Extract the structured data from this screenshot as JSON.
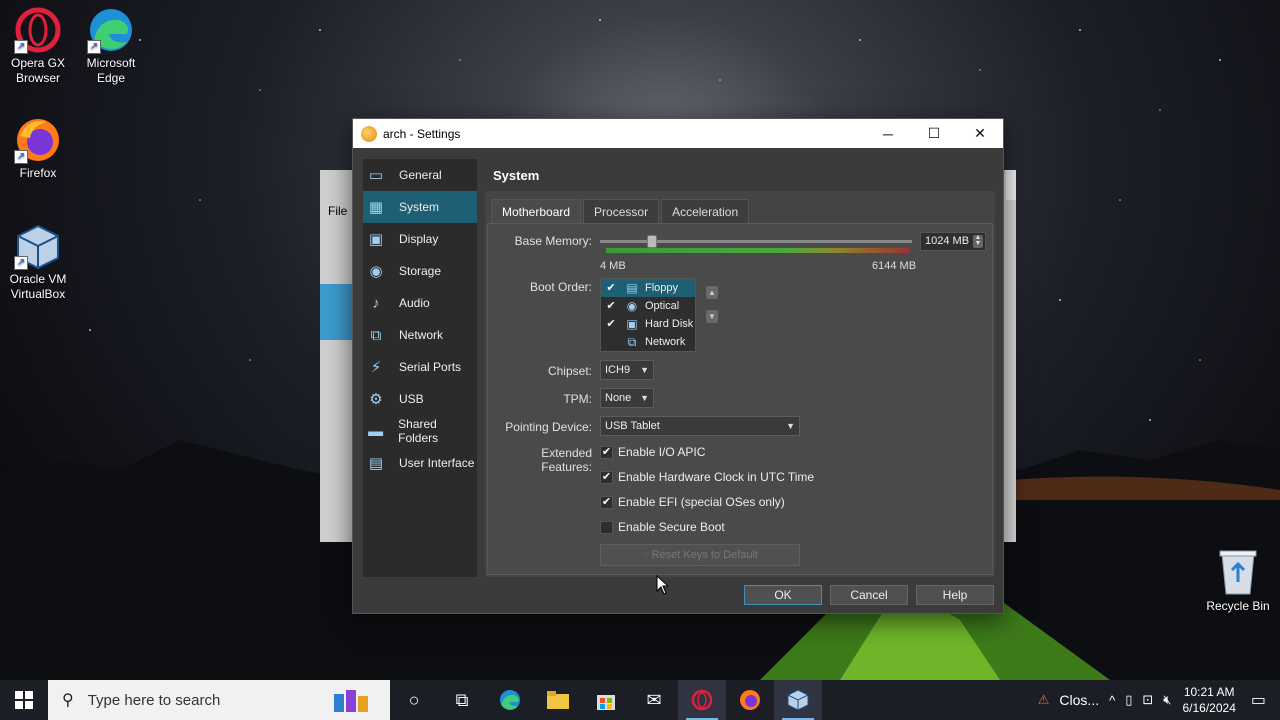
{
  "desktop": {
    "icons": [
      {
        "label": "Opera GX Browser",
        "icon": "opera-gx-icon"
      },
      {
        "label": "Microsoft Edge",
        "icon": "edge-icon"
      },
      {
        "label": "Firefox",
        "icon": "firefox-icon"
      },
      {
        "label": "Oracle VM VirtualBox",
        "icon": "virtualbox-icon"
      }
    ],
    "recycle_bin": "Recycle Bin"
  },
  "background_window": {
    "file_menu": "File"
  },
  "dialog": {
    "title": "arch - Settings",
    "window_buttons": {
      "minimize": "─",
      "maximize": "☐",
      "close": "✕"
    },
    "sidebar": [
      {
        "label": "General",
        "icon": "general-icon",
        "glyph": "▭"
      },
      {
        "label": "System",
        "icon": "system-icon",
        "glyph": "▦",
        "active": true
      },
      {
        "label": "Display",
        "icon": "display-icon",
        "glyph": "▣"
      },
      {
        "label": "Storage",
        "icon": "storage-icon",
        "glyph": "◉"
      },
      {
        "label": "Audio",
        "icon": "audio-icon",
        "glyph": "♪"
      },
      {
        "label": "Network",
        "icon": "network-icon",
        "glyph": "⧉"
      },
      {
        "label": "Serial Ports",
        "icon": "serial-ports-icon",
        "glyph": "⚡"
      },
      {
        "label": "USB",
        "icon": "usb-icon",
        "glyph": "⚙"
      },
      {
        "label": "Shared Folders",
        "icon": "shared-folders-icon",
        "glyph": "▬"
      },
      {
        "label": "User Interface",
        "icon": "user-interface-icon",
        "glyph": "▤"
      }
    ],
    "section_title": "System",
    "tabs": [
      {
        "label": "Motherboard",
        "active": true
      },
      {
        "label": "Processor"
      },
      {
        "label": "Acceleration"
      }
    ],
    "motherboard": {
      "base_memory_label": "Base Memory:",
      "base_memory_value": "1024 MB",
      "base_memory_fraction": 0.167,
      "memory_min": "4 MB",
      "memory_max": "6144 MB",
      "boot_order_label": "Boot Order:",
      "boot_order": [
        {
          "label": "Floppy",
          "checked": true,
          "icon": "floppy-icon",
          "glyph": "▤",
          "selected": true
        },
        {
          "label": "Optical",
          "checked": true,
          "icon": "optical-icon",
          "glyph": "◉"
        },
        {
          "label": "Hard Disk",
          "checked": true,
          "icon": "hard-disk-icon",
          "glyph": "▣"
        },
        {
          "label": "Network",
          "checked": false,
          "icon": "network-boot-icon",
          "glyph": "⧉"
        }
      ],
      "chipset_label": "Chipset:",
      "chipset_value": "ICH9",
      "tpm_label": "TPM:",
      "tpm_value": "None",
      "pointing_label": "Pointing Device:",
      "pointing_value": "USB Tablet",
      "extended_label": "Extended Features:",
      "features": [
        {
          "label": "Enable I/O APIC",
          "checked": true
        },
        {
          "label": "Enable Hardware Clock in UTC Time",
          "checked": true
        },
        {
          "label": "Enable EFI (special OSes only)",
          "checked": true
        },
        {
          "label": "Enable Secure Boot",
          "checked": false
        }
      ],
      "reset_keys": "Reset Keys to Default"
    },
    "buttons": {
      "ok": "OK",
      "cancel": "Cancel",
      "help": "Help"
    }
  },
  "taskbar": {
    "search_placeholder": "Type here to search",
    "tray_notification": "Clos...",
    "time": "10:21 AM",
    "date": "6/16/2024"
  },
  "colors": {
    "accent": "#1e5f73",
    "taskbar": "#1b1e24"
  }
}
